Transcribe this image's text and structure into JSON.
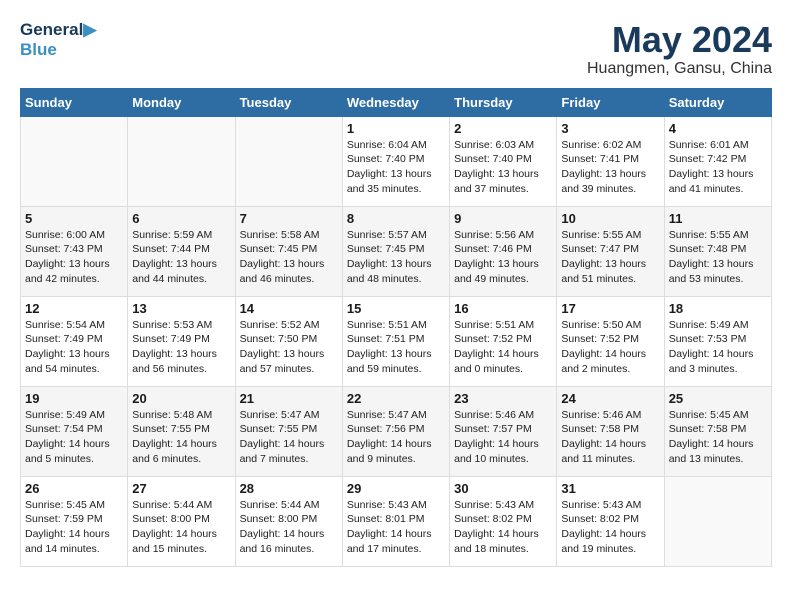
{
  "logo": {
    "line1": "General",
    "line2": "Blue"
  },
  "title": "May 2024",
  "subtitle": "Huangmen, Gansu, China",
  "days_header": [
    "Sunday",
    "Monday",
    "Tuesday",
    "Wednesday",
    "Thursday",
    "Friday",
    "Saturday"
  ],
  "weeks": [
    [
      {
        "day": "",
        "info": ""
      },
      {
        "day": "",
        "info": ""
      },
      {
        "day": "",
        "info": ""
      },
      {
        "day": "1",
        "info": "Sunrise: 6:04 AM\nSunset: 7:40 PM\nDaylight: 13 hours\nand 35 minutes."
      },
      {
        "day": "2",
        "info": "Sunrise: 6:03 AM\nSunset: 7:40 PM\nDaylight: 13 hours\nand 37 minutes."
      },
      {
        "day": "3",
        "info": "Sunrise: 6:02 AM\nSunset: 7:41 PM\nDaylight: 13 hours\nand 39 minutes."
      },
      {
        "day": "4",
        "info": "Sunrise: 6:01 AM\nSunset: 7:42 PM\nDaylight: 13 hours\nand 41 minutes."
      }
    ],
    [
      {
        "day": "5",
        "info": "Sunrise: 6:00 AM\nSunset: 7:43 PM\nDaylight: 13 hours\nand 42 minutes."
      },
      {
        "day": "6",
        "info": "Sunrise: 5:59 AM\nSunset: 7:44 PM\nDaylight: 13 hours\nand 44 minutes."
      },
      {
        "day": "7",
        "info": "Sunrise: 5:58 AM\nSunset: 7:45 PM\nDaylight: 13 hours\nand 46 minutes."
      },
      {
        "day": "8",
        "info": "Sunrise: 5:57 AM\nSunset: 7:45 PM\nDaylight: 13 hours\nand 48 minutes."
      },
      {
        "day": "9",
        "info": "Sunrise: 5:56 AM\nSunset: 7:46 PM\nDaylight: 13 hours\nand 49 minutes."
      },
      {
        "day": "10",
        "info": "Sunrise: 5:55 AM\nSunset: 7:47 PM\nDaylight: 13 hours\nand 51 minutes."
      },
      {
        "day": "11",
        "info": "Sunrise: 5:55 AM\nSunset: 7:48 PM\nDaylight: 13 hours\nand 53 minutes."
      }
    ],
    [
      {
        "day": "12",
        "info": "Sunrise: 5:54 AM\nSunset: 7:49 PM\nDaylight: 13 hours\nand 54 minutes."
      },
      {
        "day": "13",
        "info": "Sunrise: 5:53 AM\nSunset: 7:49 PM\nDaylight: 13 hours\nand 56 minutes."
      },
      {
        "day": "14",
        "info": "Sunrise: 5:52 AM\nSunset: 7:50 PM\nDaylight: 13 hours\nand 57 minutes."
      },
      {
        "day": "15",
        "info": "Sunrise: 5:51 AM\nSunset: 7:51 PM\nDaylight: 13 hours\nand 59 minutes."
      },
      {
        "day": "16",
        "info": "Sunrise: 5:51 AM\nSunset: 7:52 PM\nDaylight: 14 hours\nand 0 minutes."
      },
      {
        "day": "17",
        "info": "Sunrise: 5:50 AM\nSunset: 7:52 PM\nDaylight: 14 hours\nand 2 minutes."
      },
      {
        "day": "18",
        "info": "Sunrise: 5:49 AM\nSunset: 7:53 PM\nDaylight: 14 hours\nand 3 minutes."
      }
    ],
    [
      {
        "day": "19",
        "info": "Sunrise: 5:49 AM\nSunset: 7:54 PM\nDaylight: 14 hours\nand 5 minutes."
      },
      {
        "day": "20",
        "info": "Sunrise: 5:48 AM\nSunset: 7:55 PM\nDaylight: 14 hours\nand 6 minutes."
      },
      {
        "day": "21",
        "info": "Sunrise: 5:47 AM\nSunset: 7:55 PM\nDaylight: 14 hours\nand 7 minutes."
      },
      {
        "day": "22",
        "info": "Sunrise: 5:47 AM\nSunset: 7:56 PM\nDaylight: 14 hours\nand 9 minutes."
      },
      {
        "day": "23",
        "info": "Sunrise: 5:46 AM\nSunset: 7:57 PM\nDaylight: 14 hours\nand 10 minutes."
      },
      {
        "day": "24",
        "info": "Sunrise: 5:46 AM\nSunset: 7:58 PM\nDaylight: 14 hours\nand 11 minutes."
      },
      {
        "day": "25",
        "info": "Sunrise: 5:45 AM\nSunset: 7:58 PM\nDaylight: 14 hours\nand 13 minutes."
      }
    ],
    [
      {
        "day": "26",
        "info": "Sunrise: 5:45 AM\nSunset: 7:59 PM\nDaylight: 14 hours\nand 14 minutes."
      },
      {
        "day": "27",
        "info": "Sunrise: 5:44 AM\nSunset: 8:00 PM\nDaylight: 14 hours\nand 15 minutes."
      },
      {
        "day": "28",
        "info": "Sunrise: 5:44 AM\nSunset: 8:00 PM\nDaylight: 14 hours\nand 16 minutes."
      },
      {
        "day": "29",
        "info": "Sunrise: 5:43 AM\nSunset: 8:01 PM\nDaylight: 14 hours\nand 17 minutes."
      },
      {
        "day": "30",
        "info": "Sunrise: 5:43 AM\nSunset: 8:02 PM\nDaylight: 14 hours\nand 18 minutes."
      },
      {
        "day": "31",
        "info": "Sunrise: 5:43 AM\nSunset: 8:02 PM\nDaylight: 14 hours\nand 19 minutes."
      },
      {
        "day": "",
        "info": ""
      }
    ]
  ]
}
